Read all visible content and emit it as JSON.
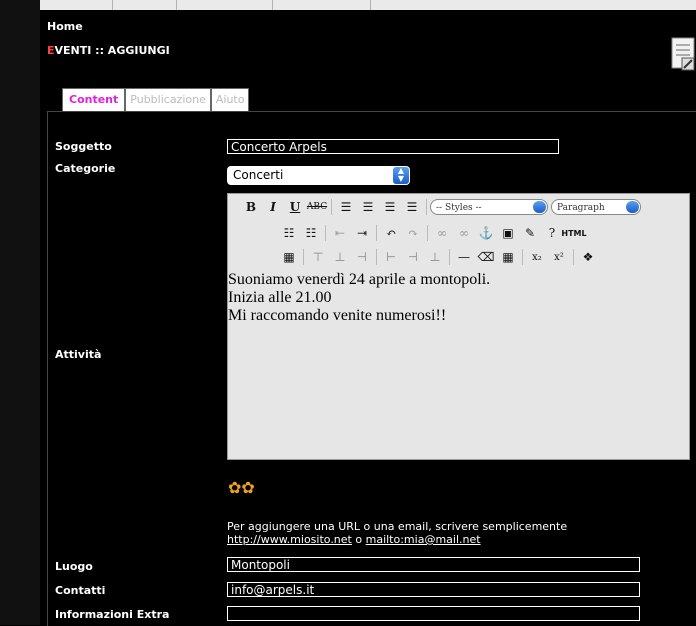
{
  "nav": {
    "home": "Home"
  },
  "page": {
    "title_first": "E",
    "title_rest": "VENTI :: AGGIUNGI"
  },
  "tabs": [
    {
      "label": "Content"
    },
    {
      "label": "Pubblicazione"
    },
    {
      "label": "Aiuto"
    }
  ],
  "form": {
    "soggetto_label": "Soggetto",
    "soggetto_value": "Concerto Arpels",
    "categorie_label": "Categorie",
    "categorie_value": "Concerti",
    "attivita_label": "Attività",
    "luogo_label": "Luogo",
    "luogo_value": "Montopoli",
    "contatti_label": "Contatti",
    "contatti_value": "info@arpels.it",
    "extra_label": "Informazioni Extra",
    "extra_value": ""
  },
  "editor": {
    "styles_label": "-- Styles --",
    "format_label": "Paragraph",
    "html_label": "HTML",
    "lines": [
      "Suoniamo venerdì 24 aprile a montopoli.",
      "Inizia alle 21.00",
      "Mi raccomando venite numerosi!!"
    ]
  },
  "hint": {
    "text": "Per aggiungere una URL o una email, scrivere semplicemente",
    "url": "http://www.miosito.net",
    "or": "o",
    "mail": "mailto:mia@mail.net"
  },
  "colors": {
    "active_tab": "#e020e0",
    "title_accent": "#ff4040"
  }
}
